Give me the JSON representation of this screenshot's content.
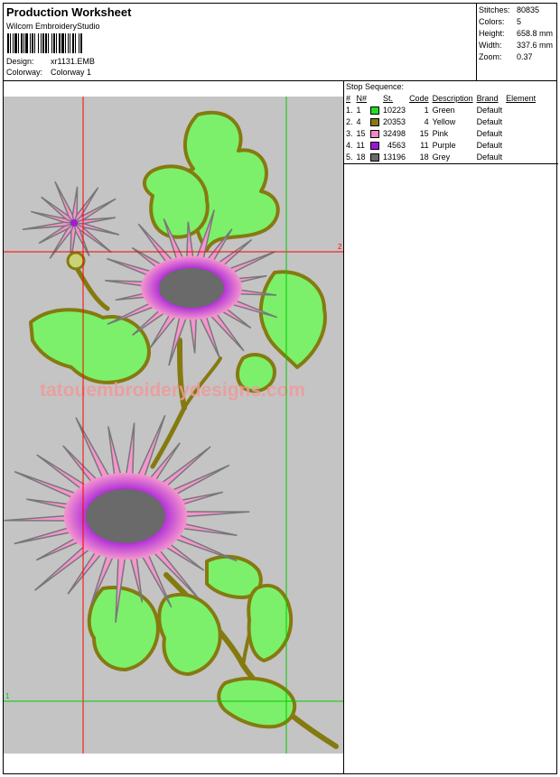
{
  "header": {
    "title": "Production Worksheet",
    "software": "Wilcom EmbroideryStudio",
    "design_label": "Design:",
    "design_value": "xr1131.EMB",
    "colorway_label": "Colorway:",
    "colorway_value": "Colorway 1"
  },
  "stats": [
    {
      "label": "Stitches:",
      "value": "80835"
    },
    {
      "label": "Colors:",
      "value": "5"
    },
    {
      "label": "Height:",
      "value": "658.8 mm"
    },
    {
      "label": "Width:",
      "value": "337.6 mm"
    },
    {
      "label": "Zoom:",
      "value": "0.37"
    }
  ],
  "stop_sequence": {
    "title": "Stop Sequence:",
    "columns": [
      "#",
      "N#",
      "St.",
      "Code",
      "Description",
      "Brand",
      "Element"
    ],
    "rows": [
      {
        "num": "1.",
        "n": "1",
        "color": "#22dd22",
        "st": "10223",
        "code": "1",
        "desc": "Green",
        "brand": "Default",
        "element": ""
      },
      {
        "num": "2.",
        "n": "4",
        "color": "#857a10",
        "st": "20353",
        "code": "4",
        "desc": "Yellow",
        "brand": "Default",
        "element": ""
      },
      {
        "num": "3.",
        "n": "15",
        "color": "#f088c8",
        "st": "32498",
        "code": "15",
        "desc": "Pink",
        "brand": "Default",
        "element": ""
      },
      {
        "num": "4.",
        "n": "11",
        "color": "#9a16d6",
        "st": "4563",
        "code": "11",
        "desc": "Purple",
        "brand": "Default",
        "element": ""
      },
      {
        "num": "5.",
        "n": "18",
        "color": "#6a6a6a",
        "st": "13196",
        "code": "18",
        "desc": "Grey",
        "brand": "Default",
        "element": ""
      }
    ]
  },
  "design": {
    "watermark": "tatouembroiderydesigns.com",
    "guide_labels": [
      "2",
      "1"
    ],
    "colors": {
      "background": "#c4c4c4",
      "leaf_fill": "#7cf06a",
      "leaf_edge": "#857a10",
      "petal": "#f595cf",
      "petal_edge": "#777777",
      "center_ring": "#a21bd8",
      "center": "#6a6a6a",
      "guide_red": "#ff0000",
      "guide_green": "#00cc00"
    }
  }
}
